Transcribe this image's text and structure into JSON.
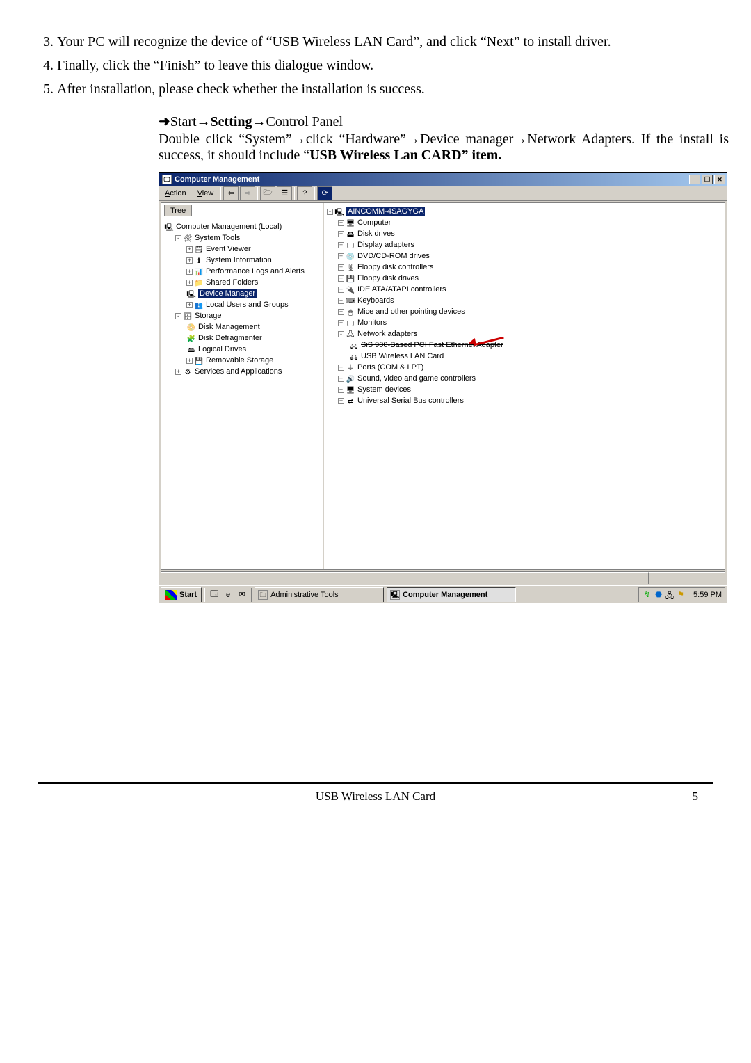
{
  "instructions": {
    "i3": "Your PC will recognize the device of “USB Wireless LAN Card”, and click “Next” to install driver.",
    "i4": " Finally, click the “Finish” to leave this dialogue window.",
    "i5": " After installation, please check whether the installation is success."
  },
  "path_line": {
    "arrow": "➜",
    "seg1": "Start→",
    "seg2_bold": "Setting",
    "seg3": "→Control Panel"
  },
  "explain": {
    "p1": "Double click “System”→click “Hardware”→Device manager→Network Adapters. If the install is success, it should include “",
    "p1_bold": "USB Wireless Lan CARD” item."
  },
  "window": {
    "title": "Computer Management",
    "menu_action": "Action",
    "menu_view": "View",
    "tree_tab": "Tree",
    "tree": {
      "root": "Computer Management (Local)",
      "system_tools": "System Tools",
      "event_viewer": "Event Viewer",
      "system_information": "System Information",
      "perf": "Performance Logs and Alerts",
      "shared": "Shared Folders",
      "devmgr": "Device Manager",
      "local_users": "Local Users and Groups",
      "storage": "Storage",
      "disk_mgmt": "Disk Management",
      "defrag": "Disk Defragmenter",
      "logical": "Logical Drives",
      "removable": "Removable Storage",
      "services": "Services and Applications"
    },
    "device_tree": {
      "root": "AINCOMM-4SAGYGA",
      "computer": "Computer",
      "disk_drives": "Disk drives",
      "display": "Display adapters",
      "dvd": "DVD/CD-ROM drives",
      "floppy_ctrl": "Floppy disk controllers",
      "floppy_drives": "Floppy disk drives",
      "ide": "IDE ATA/ATAPI controllers",
      "keyboards": "Keyboards",
      "mice": "Mice and other pointing devices",
      "monitors": "Monitors",
      "netadapt": "Network adapters",
      "sis": "SiS 900-Based PCI Fast Ethernet Adapter",
      "usbwlan": "USB Wireless LAN Card",
      "ports": "Ports (COM & LPT)",
      "sound": "Sound, video and game controllers",
      "sysdev": "System devices",
      "usbctrl": "Universal Serial Bus controllers"
    }
  },
  "taskbar": {
    "start": "Start",
    "admin_tools": "Administrative Tools",
    "comp_mgmt": "Computer Management",
    "clock": "5:59 PM"
  },
  "footer": {
    "title": "USB Wireless LAN Card",
    "page": "5"
  }
}
